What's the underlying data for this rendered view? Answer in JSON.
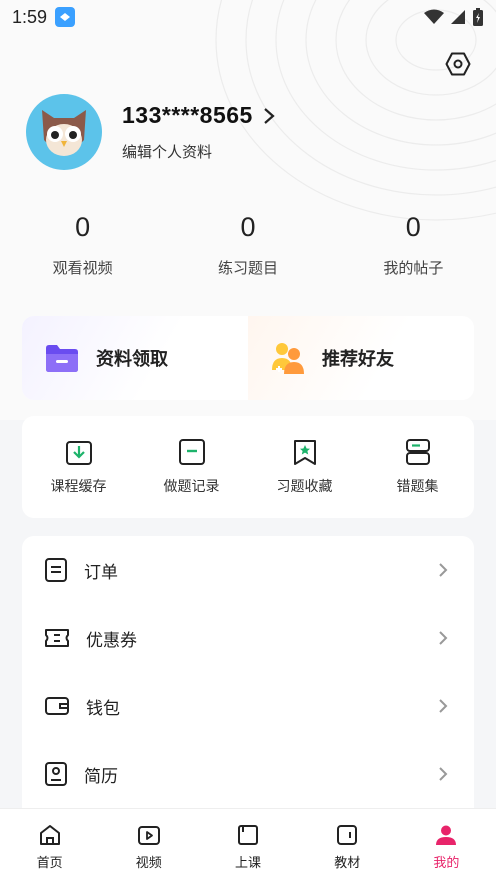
{
  "status_bar": {
    "time": "1:59"
  },
  "profile": {
    "phone": "133****8565",
    "edit_label": "编辑个人资料"
  },
  "stats": [
    {
      "value": "0",
      "label": "观看视频"
    },
    {
      "value": "0",
      "label": "练习题目"
    },
    {
      "value": "0",
      "label": "我的帖子"
    }
  ],
  "promo": {
    "materials_label": "资料领取",
    "recommend_label": "推荐好友"
  },
  "quick_actions": [
    {
      "label": "课程缓存",
      "icon": "download-icon"
    },
    {
      "label": "做题记录",
      "icon": "record-icon"
    },
    {
      "label": "习题收藏",
      "icon": "bookmark-icon"
    },
    {
      "label": "错题集",
      "icon": "wrong-set-icon"
    }
  ],
  "menu": [
    {
      "label": "订单",
      "icon": "order-icon"
    },
    {
      "label": "优惠券",
      "icon": "coupon-icon"
    },
    {
      "label": "钱包",
      "icon": "wallet-icon"
    },
    {
      "label": "简历",
      "icon": "resume-icon"
    }
  ],
  "bottom_nav": [
    {
      "label": "首页",
      "icon": "home-icon"
    },
    {
      "label": "视频",
      "icon": "video-icon"
    },
    {
      "label": "上课",
      "icon": "class-icon"
    },
    {
      "label": "教材",
      "icon": "textbook-icon"
    },
    {
      "label": "我的",
      "icon": "profile-icon",
      "active": true
    }
  ],
  "colors": {
    "accent": "#e8246a",
    "promo_purple": "#6a4cf0",
    "promo_orange": "#ff9a3c",
    "green": "#1db36b"
  }
}
